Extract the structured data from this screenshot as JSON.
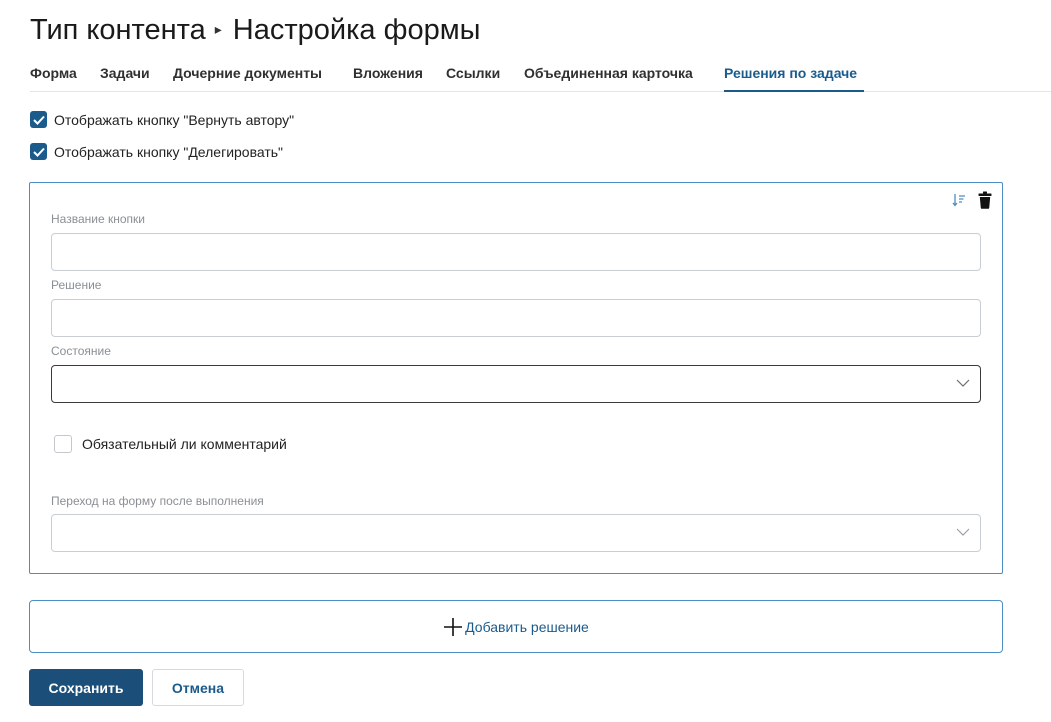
{
  "header": {
    "title_part1": "Тип контента",
    "title_separator": "▸",
    "title_part2": "Настройка формы"
  },
  "tabs": [
    {
      "label": "Форма",
      "active": false
    },
    {
      "label": "Задачи",
      "active": false
    },
    {
      "label": "Дочерние документы",
      "active": false
    },
    {
      "label": "Вложения",
      "active": false
    },
    {
      "label": "Ссылки",
      "active": false
    },
    {
      "label": "Объединенная карточка",
      "active": false
    },
    {
      "label": "Решения по задаче",
      "active": true
    }
  ],
  "options": {
    "return_to_author": {
      "label": "Отображать кнопку \"Вернуть автору\"",
      "checked": true
    },
    "delegate": {
      "label": "Отображать кнопку \"Делегировать\"",
      "checked": true
    }
  },
  "decision_card": {
    "button_name": {
      "label": "Название кнопки",
      "value": ""
    },
    "decision": {
      "label": "Решение",
      "value": ""
    },
    "state": {
      "label": "Состояние",
      "value": ""
    },
    "comment_required": {
      "label": "Обязательный ли комментарий",
      "checked": false
    },
    "next_form": {
      "label": "Переход на форму после выполнения",
      "value": ""
    },
    "icons": [
      "sort-icon",
      "trash-icon"
    ]
  },
  "add_decision": {
    "label": "Добавить решение",
    "icon": "plus-icon"
  },
  "actions": {
    "save_label": "Сохранить",
    "cancel_label": "Отмена"
  },
  "colors": {
    "accent": "#1b5b8c",
    "primary_button": "#1b4f7a",
    "card_border": "#4d8ec4"
  }
}
